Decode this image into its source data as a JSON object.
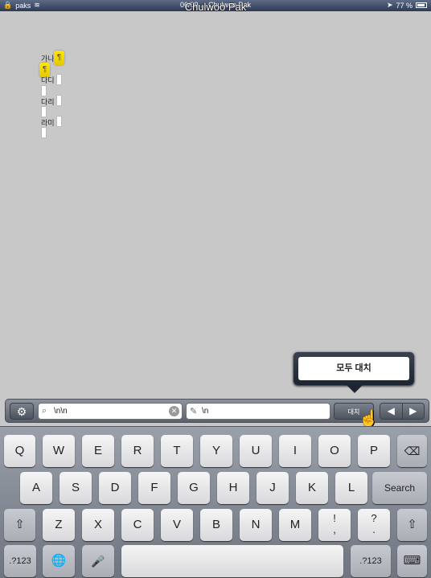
{
  "statusbar": {
    "carrier": "paks",
    "title": "06/09 ... Chulwoo Pak",
    "battery": "77 %"
  },
  "caption": "Chulwoo Pak",
  "document": {
    "lines": [
      "가나",
      "다디",
      "다리",
      "라미"
    ],
    "pilcrow": "¶"
  },
  "popover": {
    "replace_all_label": "모두 대치"
  },
  "findbar": {
    "settings_icon": "gear-icon",
    "search_value": "\\n\\n",
    "replace_value": "\\n",
    "replace_label": "대치",
    "prev_icon": "◀",
    "next_icon": "▶"
  },
  "keyboard": {
    "row1": [
      "Q",
      "W",
      "E",
      "R",
      "T",
      "Y",
      "U",
      "I",
      "O",
      "P"
    ],
    "row2": [
      "A",
      "S",
      "D",
      "F",
      "G",
      "H",
      "J",
      "K",
      "L"
    ],
    "row3": [
      "Z",
      "X",
      "C",
      "V",
      "B",
      "N",
      "M"
    ],
    "search_label": "Search",
    "numbers_label": ".?123",
    "punct1_top": "!",
    "punct1_bottom": ",",
    "punct2_top": "?",
    "punct2_bottom": "."
  }
}
